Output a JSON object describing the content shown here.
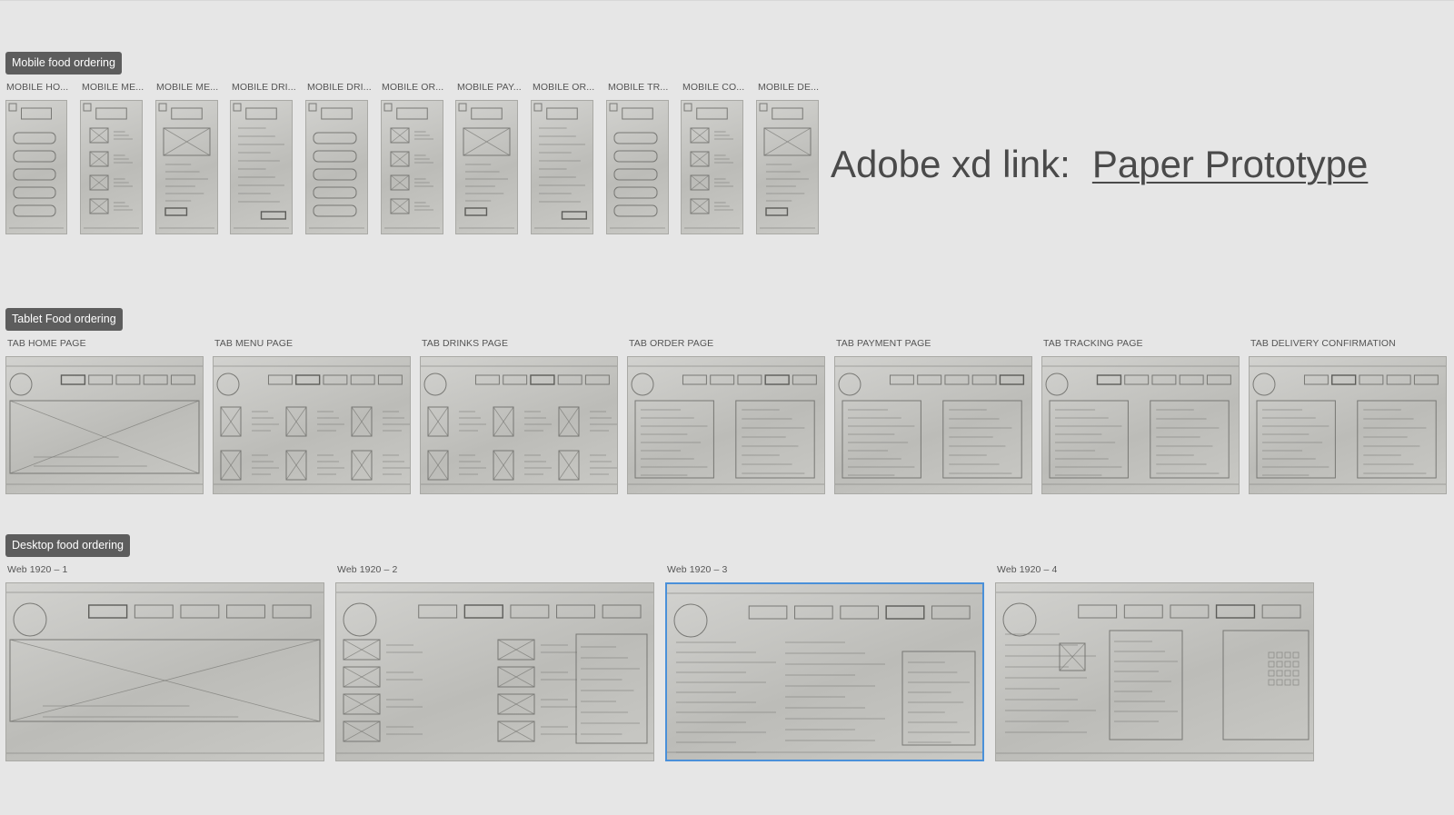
{
  "sections": {
    "mobile": {
      "label": "Mobile food ordering",
      "frames": [
        {
          "label": "MOBILE HO..."
        },
        {
          "label": "MOBILE ME..."
        },
        {
          "label": "MOBILE ME..."
        },
        {
          "label": "MOBILE DRI..."
        },
        {
          "label": "MOBILE DRI..."
        },
        {
          "label": "MOBILE OR..."
        },
        {
          "label": "MOBILE PAY..."
        },
        {
          "label": "MOBILE OR..."
        },
        {
          "label": "MOBILE TR..."
        },
        {
          "label": "MOBILE CO..."
        },
        {
          "label": "MOBILE DE..."
        }
      ]
    },
    "tablet": {
      "label": "Tablet Food ordering",
      "frames": [
        {
          "label": "TAB HOME PAGE"
        },
        {
          "label": "TAB MENU PAGE"
        },
        {
          "label": "TAB DRINKS PAGE"
        },
        {
          "label": "TAB ORDER  PAGE"
        },
        {
          "label": "TAB PAYMENT PAGE"
        },
        {
          "label": "TAB TRACKING PAGE"
        },
        {
          "label": "TAB DELIVERY CONFIRMATION"
        }
      ]
    },
    "desktop": {
      "label": "Desktop food ordering",
      "frames": [
        {
          "label": "Web 1920 – 1"
        },
        {
          "label": "Web 1920 – 2"
        },
        {
          "label": "Web 1920 – 3",
          "selected": true
        },
        {
          "label": "Web 1920 – 4"
        }
      ]
    }
  },
  "xd_link": {
    "prefix": "Adobe xd link:",
    "link_text": "Paper Prototype"
  },
  "colors": {
    "canvas": "#e6e6e6",
    "tag_bg": "#5d5d5d",
    "selection": "#4a90d9"
  }
}
